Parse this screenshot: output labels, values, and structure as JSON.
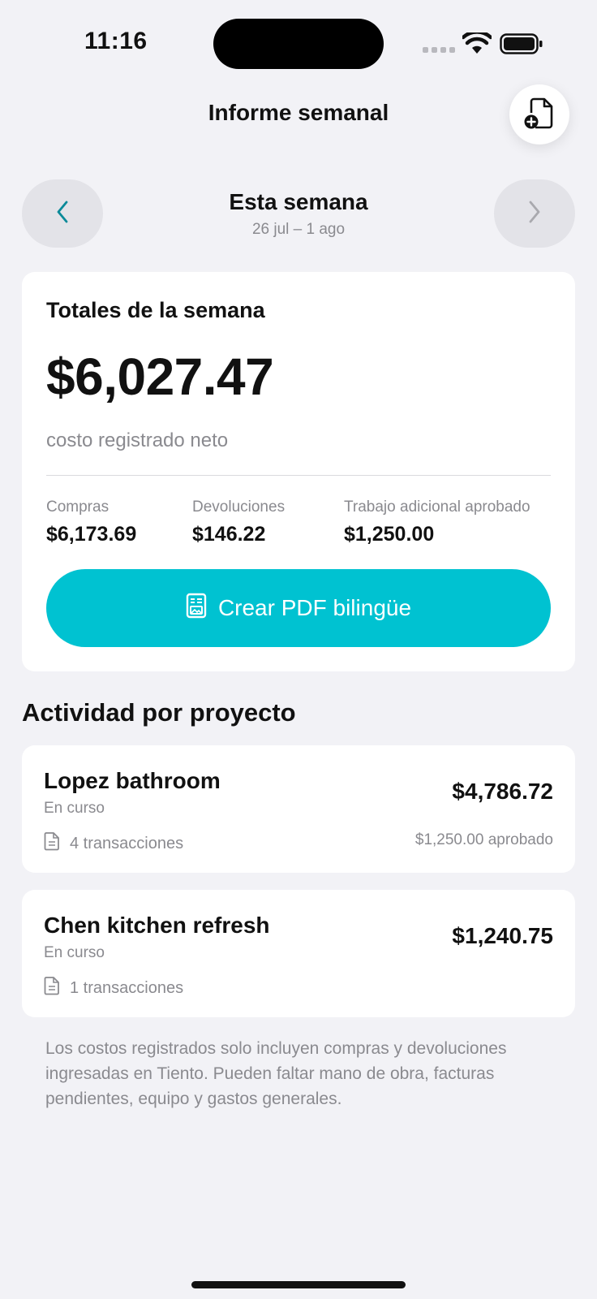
{
  "status_bar": {
    "time": "11:16"
  },
  "header": {
    "title": "Informe semanal"
  },
  "week_nav": {
    "title": "Esta semana",
    "range": "26 jul – 1 ago"
  },
  "totals": {
    "label": "Totales de la semana",
    "amount": "$6,027.47",
    "subtitle": "costo registrado neto",
    "stats": [
      {
        "label": "Compras",
        "value": "$6,173.69"
      },
      {
        "label": "Devoluciones",
        "value": "$146.22"
      },
      {
        "label": "Trabajo adicional aprobado",
        "value": "$1,250.00"
      }
    ],
    "cta_label": "Crear PDF bilingüe"
  },
  "activity": {
    "title": "Actividad por proyecto",
    "projects": [
      {
        "name": "Lopez bathroom",
        "status": "En curso",
        "transactions": "4 transacciones",
        "amount": "$4,786.72",
        "approved": "$1,250.00 aprobado"
      },
      {
        "name": "Chen kitchen refresh",
        "status": "En curso",
        "transactions": "1 transacciones",
        "amount": "$1,240.75",
        "approved": ""
      }
    ]
  },
  "footnote": "Los costos registrados solo incluyen compras y devoluciones ingresadas en Tiento. Pueden faltar mano de obra, facturas pendientes, equipo y gastos generales.",
  "colors": {
    "accent": "#00c2d1",
    "background": "#f2f2f6",
    "chevron_active": "#0b8a99"
  },
  "icons": [
    "wifi-icon",
    "battery-icon",
    "document-add-icon",
    "chevron-left-icon",
    "chevron-right-icon",
    "pdf-document-icon",
    "document-icon"
  ]
}
